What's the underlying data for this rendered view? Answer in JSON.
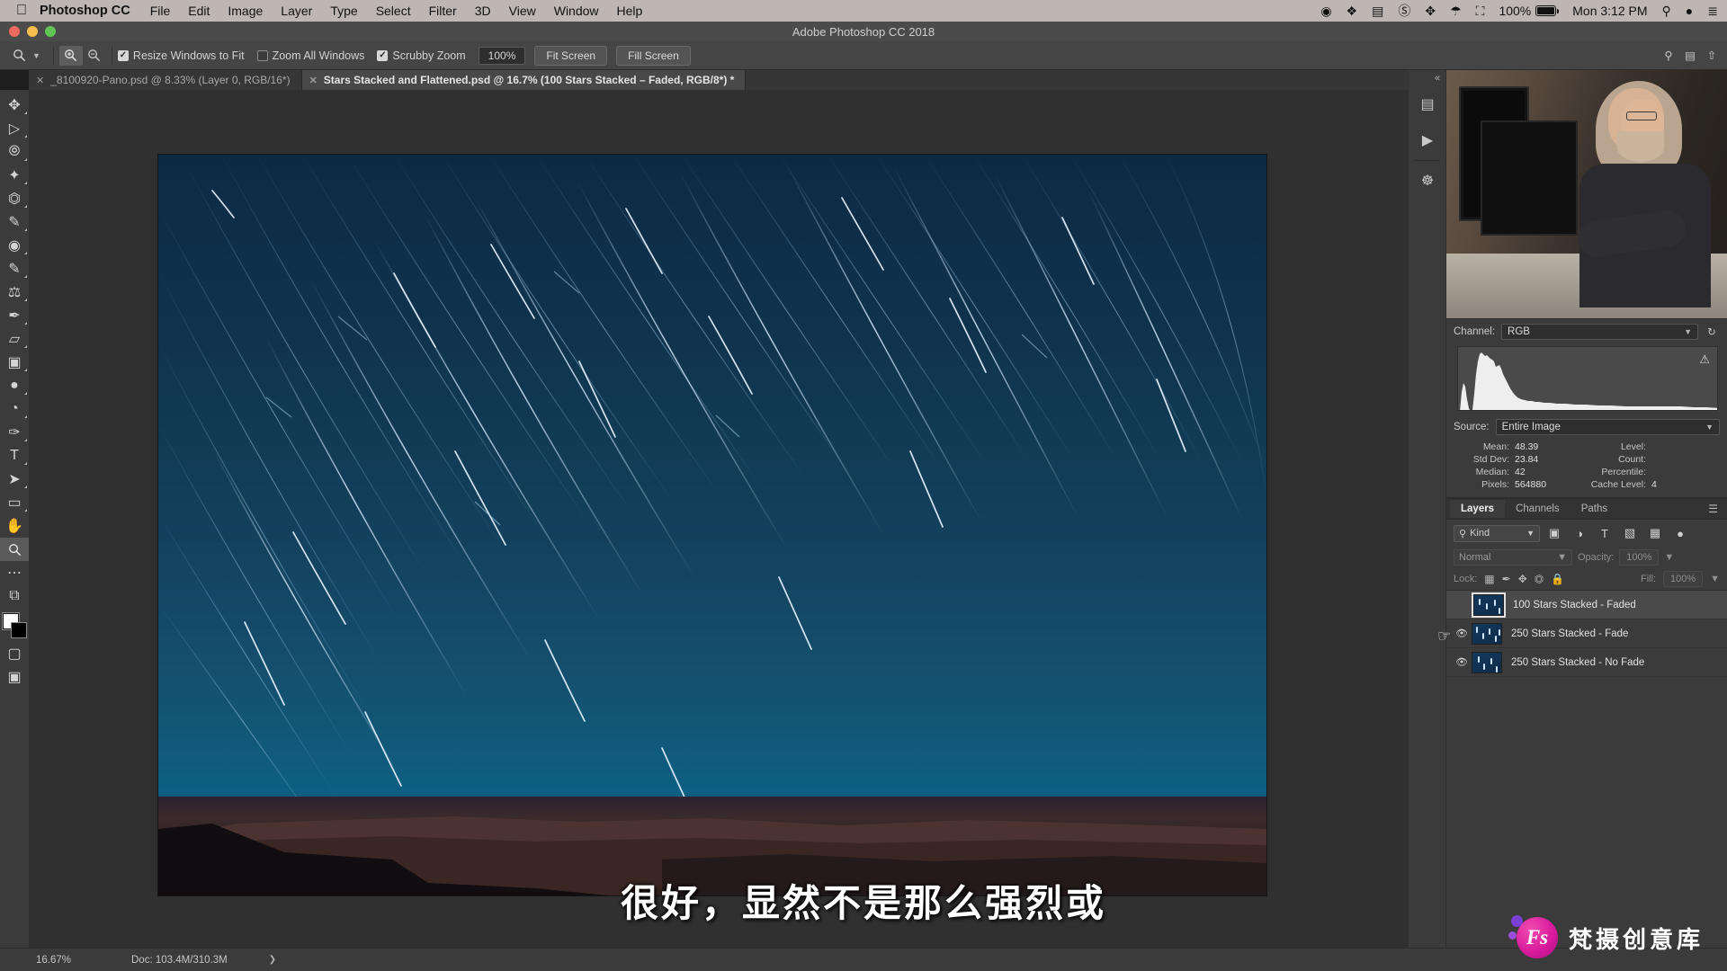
{
  "macbar": {
    "apple_icon": "apple-icon",
    "app_name": "Photoshop CC",
    "menus": [
      "File",
      "Edit",
      "Image",
      "Layer",
      "Type",
      "Select",
      "Filter",
      "3D",
      "View",
      "Window",
      "Help"
    ],
    "battery_percent": "100%",
    "clock": "Mon 3:12 PM",
    "sys_icons": [
      "record-icon",
      "dropbox-icon",
      "display-icon",
      "cc-icon",
      "bluetooth-icon",
      "wifi-icon",
      "airplay-icon",
      "battery-icon",
      "spotlight-icon",
      "siri-icon",
      "notification-center-icon"
    ]
  },
  "titlebar": {
    "title": "Adobe Photoshop CC 2018"
  },
  "options": {
    "tool_icon": "zoom-tool-icon",
    "zoom_in_icon": "zoom-in-icon",
    "zoom_out_icon": "zoom-out-icon",
    "resize_windows_label": "Resize Windows to Fit",
    "resize_windows_checked": true,
    "zoom_all_label": "Zoom All Windows",
    "zoom_all_checked": false,
    "scrubby_label": "Scrubby Zoom",
    "scrubby_checked": true,
    "zoom_value": "100%",
    "fit_screen_label": "Fit Screen",
    "fill_screen_label": "Fill Screen",
    "right_icons": [
      "search-icon",
      "workspace-icon",
      "share-icon"
    ]
  },
  "tabs": [
    {
      "label": "_8100920-Pano.psd @ 8.33% (Layer 0, RGB/16*)",
      "active": false
    },
    {
      "label": "Stars Stacked and Flattened.psd @ 16.7% (100 Stars Stacked – Faded, RGB/8*) *",
      "active": true
    }
  ],
  "toolbar": {
    "tools": [
      {
        "name": "move-tool",
        "glyph": "✥"
      },
      {
        "name": "marquee-tool",
        "glyph": "⬚"
      },
      {
        "name": "lasso-tool",
        "glyph": "○"
      },
      {
        "name": "magic-wand-tool",
        "glyph": "✦"
      },
      {
        "name": "crop-tool",
        "glyph": "⌗"
      },
      {
        "name": "eyedropper-tool",
        "glyph": "✒"
      },
      {
        "name": "healing-brush-tool",
        "glyph": "◐"
      },
      {
        "name": "brush-tool",
        "glyph": "✎"
      },
      {
        "name": "clone-stamp-tool",
        "glyph": "⚑"
      },
      {
        "name": "history-brush-tool",
        "glyph": "✐"
      },
      {
        "name": "eraser-tool",
        "glyph": "▱"
      },
      {
        "name": "gradient-tool",
        "glyph": "▣"
      },
      {
        "name": "blur-tool",
        "glyph": "●"
      },
      {
        "name": "dodge-tool",
        "glyph": "◔"
      },
      {
        "name": "pen-tool",
        "glyph": "✑"
      },
      {
        "name": "type-tool",
        "glyph": "T"
      },
      {
        "name": "path-selection-tool",
        "glyph": "➤"
      },
      {
        "name": "rectangle-tool",
        "glyph": "▭"
      },
      {
        "name": "hand-tool",
        "glyph": "✋"
      },
      {
        "name": "zoom-tool",
        "glyph": "⌕",
        "active": true
      },
      {
        "name": "edit-toolbar-button",
        "glyph": "⋯"
      },
      {
        "name": "default-colors-icon",
        "glyph": "⧉"
      }
    ],
    "quick_mask_icon": "quick-mask-icon",
    "screen_mode_icon": "screen-mode-icon"
  },
  "histogram": {
    "channel_label": "Channel:",
    "channel_value": "RGB",
    "refresh_icon": "refresh-icon",
    "warning_icon": "warning-icon",
    "source_label": "Source:",
    "source_value": "Entire Image",
    "stats_left": [
      {
        "key": "Mean:",
        "value": "48.39"
      },
      {
        "key": "Std Dev:",
        "value": "23.84"
      },
      {
        "key": "Median:",
        "value": "42"
      },
      {
        "key": "Pixels:",
        "value": "564880"
      }
    ],
    "stats_right": [
      {
        "key": "Level:",
        "value": ""
      },
      {
        "key": "Count:",
        "value": ""
      },
      {
        "key": "Percentile:",
        "value": ""
      },
      {
        "key": "Cache Level:",
        "value": "4"
      }
    ]
  },
  "layers_panel": {
    "tabs": [
      {
        "label": "Layers",
        "active": true
      },
      {
        "label": "Channels",
        "active": false
      },
      {
        "label": "Paths",
        "active": false
      }
    ],
    "menu_icon": "panel-menu-icon",
    "filter_label": "Kind",
    "filter_icons": [
      "filter-pixel-icon",
      "filter-adjustment-icon",
      "filter-type-icon",
      "filter-shape-icon",
      "filter-smart-object-icon",
      "filter-toggle-icon"
    ],
    "blend_mode": "Normal",
    "opacity_label": "Opacity:",
    "opacity_value": "100%",
    "lock_label": "Lock:",
    "lock_icons": [
      "lock-transparent-icon",
      "lock-image-icon",
      "lock-position-icon",
      "lock-artboard-icon",
      "lock-all-icon"
    ],
    "fill_label": "Fill:",
    "fill_value": "100%",
    "layers": [
      {
        "name": "100 Stars Stacked - Faded",
        "visible": false,
        "selected": true
      },
      {
        "name": "250 Stars Stacked - Fade",
        "visible": true,
        "selected": false
      },
      {
        "name": "250 Stars Stacked - No Fade",
        "visible": true,
        "selected": false
      }
    ]
  },
  "right_rail": {
    "collapse_icon": "collapse-panels-icon",
    "buttons": [
      "actions-icon",
      "play-icon",
      "libraries-icon"
    ]
  },
  "statusbar": {
    "zoom": "16.67%",
    "doc_info": "Doc: 103.4M/310.3M",
    "arrow_icon": "chevron-right-icon"
  },
  "subtitle": {
    "text": "很好，显然不是那么强烈或"
  },
  "watermark": {
    "logo_text": "Fs",
    "brand": "梵摄创意库"
  },
  "colors": {
    "panel_bg": "#3b3b3b",
    "canvas_bg": "#303030",
    "menubar_bg": "#bdb6b3",
    "accent_pink": "#d6189b",
    "sky_deep": "#0d2a44",
    "sky_glow": "#0e5f82"
  }
}
